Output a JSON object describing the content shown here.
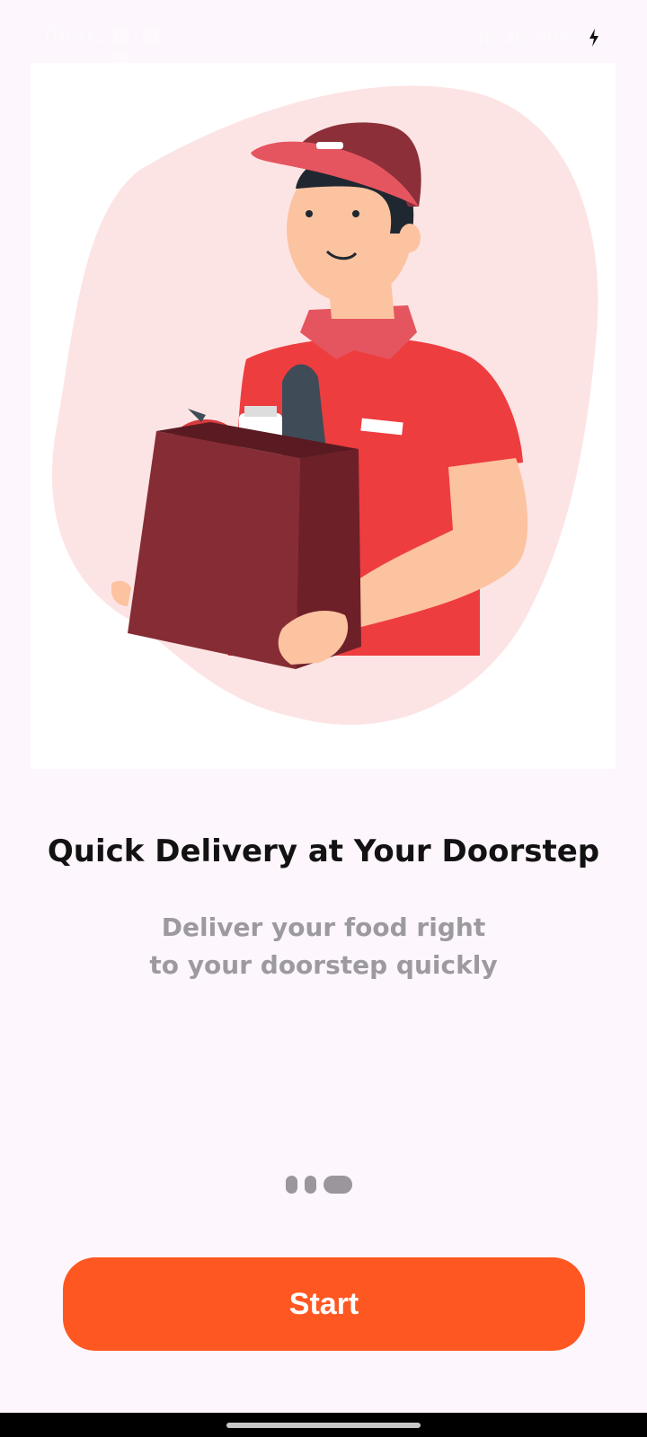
{
  "status_bar": {
    "time": "08:02",
    "right_text": "4G 4G 90%"
  },
  "onboarding": {
    "title": "Quick Delivery at Your Doorstep",
    "subtitle": "Deliver your food right to your doorstep quickly",
    "illustration": "delivery-man-holding-grocery-bag",
    "pager": {
      "total": 3,
      "active_index": 2
    },
    "start_label": "Start"
  },
  "colors": {
    "accent": "#ff5722",
    "background": "#fdf6fc",
    "title": "#121212",
    "subtitle": "#9c9a9e",
    "dot": "#9a969b"
  }
}
